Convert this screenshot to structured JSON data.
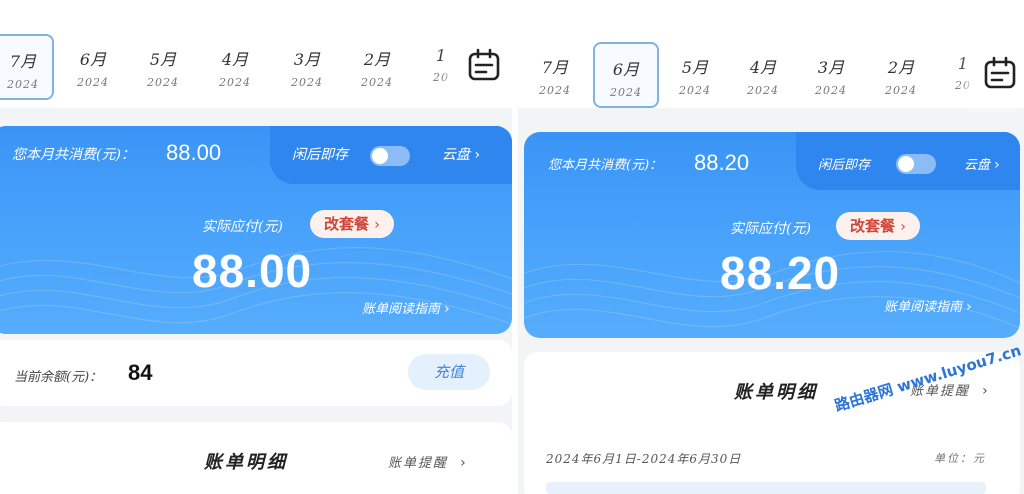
{
  "left": {
    "months": [
      {
        "month": "7月",
        "year": "2024",
        "selected": true
      },
      {
        "month": "6月",
        "year": "2024",
        "selected": false
      },
      {
        "month": "5月",
        "year": "2024",
        "selected": false
      },
      {
        "month": "4月",
        "year": "2024",
        "selected": false
      },
      {
        "month": "3月",
        "year": "2024",
        "selected": false
      },
      {
        "month": "2月",
        "year": "2024",
        "selected": false
      },
      {
        "month": "1",
        "year": "20",
        "selected": false
      }
    ],
    "card": {
      "total_label": "您本月共消费(元)：",
      "total_amount": "88.00",
      "closed_store_label": "闲后即存",
      "cloud_label": "云盘",
      "pay_label": "实际应付(元)",
      "change_plan_label": "改套餐",
      "pay_amount": "88.00",
      "guide_label": "账单阅读指南"
    },
    "balance": {
      "label": "当前余额(元)：",
      "value": "84",
      "recharge_label": "充值"
    },
    "detail": {
      "title": "账单明细",
      "reminder_label": "账单提醒"
    }
  },
  "right": {
    "months": [
      {
        "month": "7月",
        "year": "2024",
        "selected": false
      },
      {
        "month": "6月",
        "year": "2024",
        "selected": true
      },
      {
        "month": "5月",
        "year": "2024",
        "selected": false
      },
      {
        "month": "4月",
        "year": "2024",
        "selected": false
      },
      {
        "month": "3月",
        "year": "2024",
        "selected": false
      },
      {
        "month": "2月",
        "year": "2024",
        "selected": false
      },
      {
        "month": "1",
        "year": "20",
        "selected": false
      }
    ],
    "card": {
      "total_label": "您本月共消费(元)：",
      "total_amount": "88.20",
      "closed_store_label": "闲后即存",
      "cloud_label": "云盘",
      "pay_label": "实际应付(元)",
      "change_plan_label": "改套餐",
      "pay_amount": "88.20",
      "guide_label": "账单阅读指南"
    },
    "detail": {
      "title": "账单明细",
      "reminder_label": "账单提醒",
      "period": "2024年6月1日-2024年6月30日",
      "unit": "单位：元"
    }
  },
  "watermark": "路由器网 www.luyou7.cn",
  "icons": {
    "calendar": "calendar-icon",
    "chevron": "chevron-right-icon",
    "toggle": "toggle-switch"
  },
  "colors": {
    "card_blue": "#3a94f5",
    "card_tab_blue": "#2e86ee",
    "plan_button_text": "#d0473a",
    "plan_button_bg": "#fdf1ee",
    "recharge_bg": "#e4f0fb",
    "recharge_text": "#3f86d6",
    "selected_month_border": "#7fb2e5",
    "watermark": "#2b74d8"
  }
}
